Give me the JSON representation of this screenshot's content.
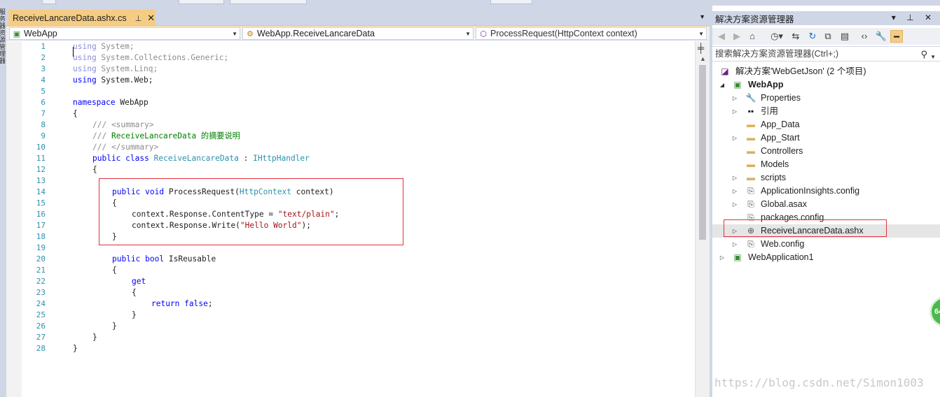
{
  "editor": {
    "tab_title": "ReceiveLancareData.ashx.cs",
    "tab_pin": "⊥",
    "tab_close": "✕",
    "nav": {
      "project": "WebApp",
      "class": "WebApp.ReceiveLancareData",
      "member": "ProcessRequest(HttpContext context)"
    },
    "line_numbers": [
      "1",
      "2",
      "3",
      "4",
      "5",
      "6",
      "7",
      "8",
      "9",
      "10",
      "11",
      "12",
      "13",
      "14",
      "15",
      "16",
      "17",
      "18",
      "19",
      "20",
      "21",
      "22",
      "23",
      "24",
      "25",
      "26",
      "27",
      "28"
    ],
    "code": {
      "l1": [
        "using",
        " System;"
      ],
      "l2": [
        "using",
        " System.Collections.Generic;"
      ],
      "l3": [
        "using",
        " System.Linq;"
      ],
      "l4": [
        "using",
        " System.Web;"
      ],
      "l6": [
        "namespace",
        " WebApp"
      ],
      "l7": "{",
      "l8": "/// <summary>",
      "l9a": "///",
      "l9b": " ReceiveLancareData 的摘要说明",
      "l10": "/// </summary>",
      "l11": [
        "public",
        " ",
        "class",
        " ",
        "ReceiveLancareData",
        " : ",
        "IHttpHandler"
      ],
      "l12": "{",
      "l14": [
        "public",
        " ",
        "void",
        " ProcessRequest(",
        "HttpContext",
        " context)"
      ],
      "l15": "{",
      "l16": [
        "context.Response.ContentType = ",
        "\"text/plain\"",
        ";"
      ],
      "l17": [
        "context.Response.Write(",
        "\"Hello World\"",
        ");"
      ],
      "l18": "}",
      "l20": [
        "public",
        " ",
        "bool",
        " IsReusable"
      ],
      "l21": "{",
      "l22": "get",
      "l23": "{",
      "l24": [
        "return",
        " ",
        "false",
        ";"
      ],
      "l25": "}",
      "l26": "}",
      "l27": "}",
      "l28": "}"
    }
  },
  "solution_explorer": {
    "title": "解决方案资源管理器",
    "title_buttons": "▾ ⊥ ✕",
    "search_placeholder": "搜索解决方案资源管理器(Ctrl+;)",
    "tree": [
      {
        "label": "解决方案'WebGetJson' (2 个项目)",
        "icon": "solution-icon"
      },
      {
        "label": "WebApp",
        "icon": "web-project-icon"
      },
      {
        "label": "Properties",
        "icon": "wrench-icon"
      },
      {
        "label": "引用",
        "icon": "references-icon"
      },
      {
        "label": "App_Data",
        "icon": "folder-icon"
      },
      {
        "label": "App_Start",
        "icon": "folder-icon"
      },
      {
        "label": "Controllers",
        "icon": "folder-icon"
      },
      {
        "label": "Models",
        "icon": "folder-icon"
      },
      {
        "label": "scripts",
        "icon": "folder-icon"
      },
      {
        "label": "ApplicationInsights.config",
        "icon": "config-file-icon"
      },
      {
        "label": "Global.asax",
        "icon": "config-file-icon"
      },
      {
        "label": "packages.config",
        "icon": "config-file-icon"
      },
      {
        "label": "ReceiveLancareData.ashx",
        "icon": "handler-file-icon"
      },
      {
        "label": "Web.config",
        "icon": "config-file-icon"
      },
      {
        "label": "WebApplication1",
        "icon": "web-project-icon"
      }
    ]
  },
  "left_strip_text": "服务器资源管理器",
  "watermark": "https://blog.csdn.net/Simon1003",
  "badge_text": "64",
  "colors": {
    "keyword": "#0000ff",
    "type": "#2b91af",
    "comment": "#008000",
    "string": "#a31515",
    "tab_active": "#f5cc84",
    "highlight_box": "#e0303a"
  }
}
